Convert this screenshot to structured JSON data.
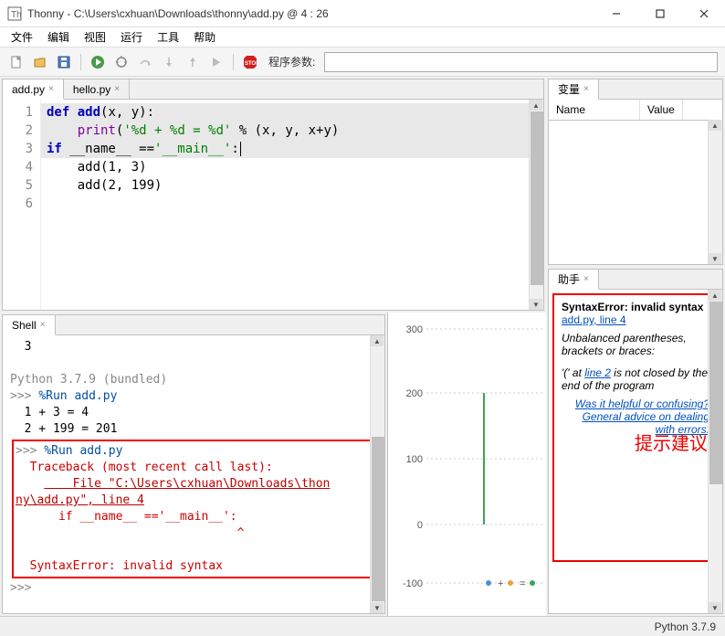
{
  "window": {
    "title": "Thonny  -  C:\\Users\\cxhuan\\Downloads\\thonny\\add.py  @  4 : 26"
  },
  "menu": {
    "items": [
      "文件",
      "编辑",
      "视图",
      "运行",
      "工具",
      "帮助"
    ]
  },
  "toolbar": {
    "args_label": "程序参数:",
    "args_value": ""
  },
  "editor": {
    "tabs": [
      {
        "label": "add.py",
        "active": true
      },
      {
        "label": "hello.py",
        "active": false
      }
    ],
    "lines": [
      "1",
      "2",
      "3",
      "4",
      "5",
      "6"
    ],
    "code": {
      "l1_def": "def",
      "l1_name": " add",
      "l1_sig": "(x, y):",
      "l2_print": "print",
      "l2_str": "'%d + %d = %d'",
      "l2_rest": " % (x, y, x+y)",
      "l3": "",
      "l4_if": "if",
      "l4_name": " __name__ ==",
      "l4_str": "'__main__'",
      "l4_colon": ":",
      "l5_call": "    add(",
      "l5_a": "1",
      "l5_c": ", ",
      "l5_b": "3",
      "l5_end": ")",
      "l6_call": "    add(",
      "l6_a": "2",
      "l6_c": ", ",
      "l6_b": "199",
      "l6_end": ")"
    }
  },
  "shell": {
    "tab": "Shell",
    "top": "  3",
    "banner": "Python 3.7.9 (bundled)",
    "run1": ">>> %Run add.py",
    "out1": "  1 + 3 = 4",
    "out2": "  2 + 199 = 201",
    "run2": ">>> %Run add.py",
    "tb1": "  Traceback (most recent call last):",
    "tb2": "    File \"C:\\Users\\cxhuan\\Downloads\\thon",
    "tb3": "ny\\add.py\", line 4",
    "tb4": "      if __name__ =='__main__':",
    "tb5": "                               ^",
    "tb6": "  SyntaxError: invalid syntax",
    "prompt": ">>>"
  },
  "chart_data": {
    "type": "line",
    "x": [
      0,
      1
    ],
    "series": [
      {
        "name": "blue",
        "values": [
          0,
          0
        ],
        "color": "#4a90d9"
      },
      {
        "name": "orange",
        "values": [
          0,
          0
        ],
        "color": "#e8a33d"
      },
      {
        "name": "green",
        "values": [
          0,
          200
        ],
        "color": "#3aa655"
      }
    ],
    "ylim": [
      -100,
      300
    ],
    "yticks": [
      -100,
      0,
      100,
      200,
      300
    ],
    "title": "",
    "xlabel": "",
    "ylabel": ""
  },
  "vars": {
    "tab": "变量",
    "col1": "Name",
    "col2": "Value"
  },
  "assistant": {
    "tab": "助手",
    "title": "SyntaxError: invalid syntax",
    "link1": "add.py, line 4",
    "msg1": "Unbalanced parentheses, brackets or braces:",
    "msg2a": "'(' at ",
    "msg2b": "line 2",
    "msg2c": " is not closed by the end of the program",
    "hint": "提示建议",
    "q1": "Was it helpful or confusing?",
    "q2": "General advice on dealing with errors."
  },
  "status": {
    "version": "Python 3.7.9"
  },
  "plot_ticks": {
    "t0": "300",
    "t1": "200",
    "t2": "100",
    "t3": "0",
    "t4": "-100"
  }
}
